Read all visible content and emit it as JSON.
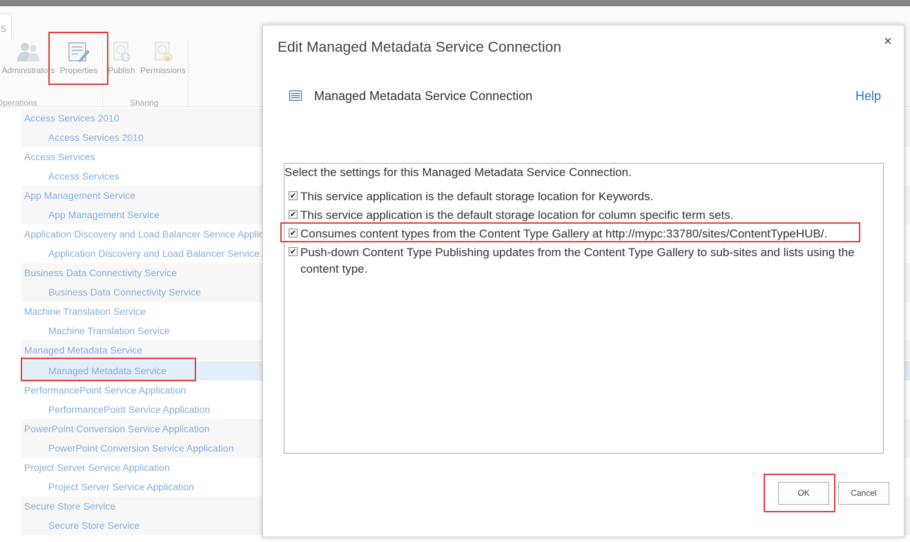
{
  "ribbon": {
    "tab_label": "S",
    "buttons": {
      "administrators": "Administrators",
      "properties": "Properties",
      "publish": "Publish",
      "permissions": "Permissions"
    },
    "groups": {
      "operations": "Operations",
      "sharing": "Sharing"
    }
  },
  "services": [
    {
      "label": "Access Services 2010",
      "level": "parent"
    },
    {
      "label": "Access Services 2010",
      "level": "child"
    },
    {
      "label": "Access Services",
      "level": "parent"
    },
    {
      "label": "Access Services",
      "level": "child"
    },
    {
      "label": "App Management Service",
      "level": "parent"
    },
    {
      "label": "App Management Service",
      "level": "child"
    },
    {
      "label": "Application Discovery and Load Balancer Service Application",
      "level": "parent"
    },
    {
      "label": "Application Discovery and Load Balancer Service Application",
      "level": "child"
    },
    {
      "label": "Business Data Connectivity Service",
      "level": "parent"
    },
    {
      "label": "Business Data Connectivity Service",
      "level": "child"
    },
    {
      "label": "Machine Translation Service",
      "level": "parent"
    },
    {
      "label": "Machine Translation Service",
      "level": "child"
    },
    {
      "label": "Managed Metadata Service",
      "level": "parent"
    },
    {
      "label": "Managed Metadata Service",
      "level": "child",
      "selected": true
    },
    {
      "label": "PerformancePoint Service Application",
      "level": "parent"
    },
    {
      "label": "PerformancePoint Service Application",
      "level": "child"
    },
    {
      "label": "PowerPoint Conversion Service Application",
      "level": "parent"
    },
    {
      "label": "PowerPoint Conversion Service Application",
      "level": "child"
    },
    {
      "label": "Project Server Service Application",
      "level": "parent"
    },
    {
      "label": "Project Server Service Application",
      "level": "child"
    },
    {
      "label": "Secure Store Service",
      "level": "parent"
    },
    {
      "label": "Secure Store Service",
      "level": "child"
    }
  ],
  "dialog": {
    "title": "Edit Managed Metadata Service Connection",
    "close_glyph": "×",
    "section_title": "Managed Metadata Service Connection",
    "help_label": "Help",
    "intro": "Select the settings for this Managed Metadata Service Connection.",
    "options": [
      {
        "label": "This service application is the default storage location for Keywords.",
        "checked": true
      },
      {
        "label": "This service application is the default storage location for column specific term sets.",
        "checked": true
      },
      {
        "label": "Consumes content types from the Content Type Gallery at http://mypc:33780/sites/ContentTypeHUB/.",
        "checked": true
      },
      {
        "label": "Push-down Content Type Publishing updates from the Content Type Gallery to sub-sites and lists using the content type.",
        "checked": true
      }
    ],
    "ok_label": "OK",
    "cancel_label": "Cancel",
    "check_glyph": "✔"
  },
  "colors": {
    "link": "#2a73c4",
    "highlight": "#e8383c",
    "selected_row": "#cde4f7"
  }
}
